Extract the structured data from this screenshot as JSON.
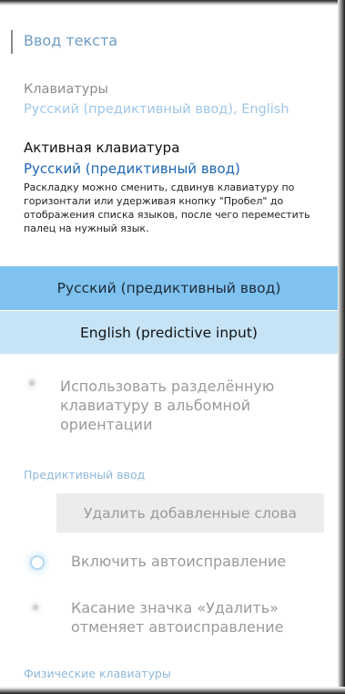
{
  "header": {
    "title": "Ввод текста"
  },
  "keyboards": {
    "label": "Клавиатуры",
    "value": "Русский (предиктивный ввод), English"
  },
  "active_keyboard": {
    "label": "Активная клавиатура",
    "value": "Русский (предиктивный ввод)",
    "hint": "Раскладку можно сменить, сдвинув клавиатуру по горизонтали или удерживая кнопку \"Пробел\" до отображения списка языков, после чего переместить палец на нужный язык."
  },
  "language_options": [
    {
      "label": "Русский (предиктивный ввод)",
      "selected": true
    },
    {
      "label": "English (predictive input)",
      "selected": false
    }
  ],
  "split_keyboard": {
    "label": "Использовать разделённую клавиатуру в альбомной ориентации"
  },
  "predictive": {
    "subhead": "Предиктивный ввод",
    "delete_words_button": "Удалить добавленные слова",
    "autocorrect_label": "Включить автоисправление",
    "delete_undo_label": "Касание значка «Удалить» отменяет автоисправление"
  },
  "physical": {
    "subhead": "Физические клавиатуры"
  },
  "colors": {
    "accent": "#1e67b5",
    "selected_option_bg": "#7fc2f0",
    "option_bg": "#c6e4f6"
  }
}
